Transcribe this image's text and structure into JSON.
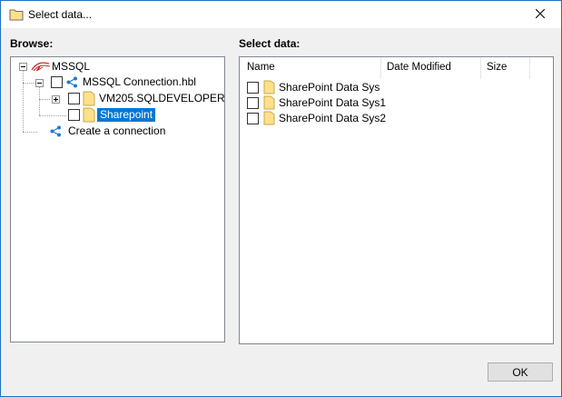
{
  "window": {
    "title": "Select data...",
    "title_icon": "folder-icon",
    "close_icon": "close-icon"
  },
  "browse": {
    "label": "Browse:",
    "tree": {
      "root": {
        "label": "MSSQL",
        "icon": "mssql-logo-icon",
        "expanded": true
      },
      "connection": {
        "label": "MSSQL Connection.hbl",
        "icon": "share-icon",
        "expanded": true,
        "checked": false
      },
      "children": [
        {
          "label": "VM205.SQLDEVELOPER",
          "icon": "folder-icon",
          "expandable": true,
          "checked": false
        },
        {
          "label": "Sharepoint",
          "icon": "folder-icon",
          "expandable": false,
          "checked": false,
          "selected": true
        }
      ],
      "create": {
        "label": "Create a connection",
        "icon": "share-icon"
      }
    }
  },
  "select_data": {
    "label": "Select data:",
    "columns": [
      "Name",
      "Date Modified",
      "Size"
    ],
    "rows": [
      {
        "name": "SharePoint Data Sys",
        "icon": "folder-icon",
        "checked": false
      },
      {
        "name": "SharePoint Data Sys1",
        "icon": "folder-icon",
        "checked": false
      },
      {
        "name": "SharePoint Data Sys2",
        "icon": "folder-icon",
        "checked": false
      }
    ]
  },
  "buttons": {
    "ok": "OK"
  },
  "colors": {
    "selection": "#0078d7",
    "folder": "#ffe08a",
    "share": "#1f7ad1",
    "mssql": "#cc2a2a"
  }
}
